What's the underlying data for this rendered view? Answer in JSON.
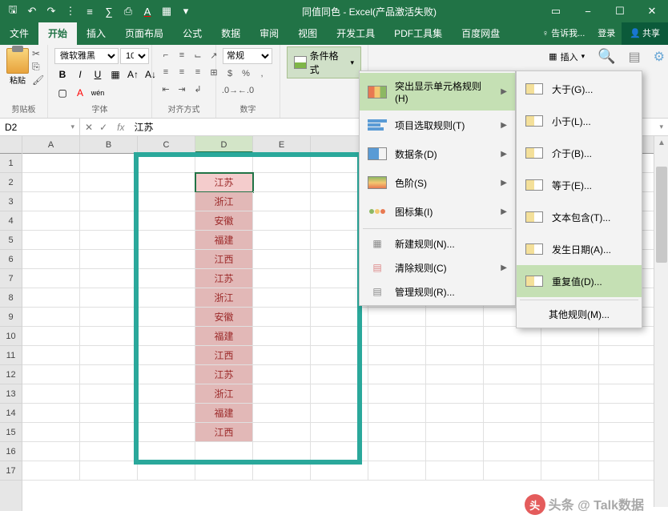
{
  "title": "同值同色 - Excel(产品激活失败)",
  "qat": [
    "🖫",
    "↶",
    "↷",
    "≡",
    "∑",
    "⎙",
    "A",
    "▦"
  ],
  "tabs": [
    "文件",
    "开始",
    "插入",
    "页面布局",
    "公式",
    "数据",
    "审阅",
    "视图",
    "开发工具",
    "PDF工具集",
    "百度网盘"
  ],
  "active_tab": "开始",
  "tellme": "♀ 告诉我...",
  "login": "登录",
  "share": "共享",
  "ribbon": {
    "paste": "粘贴",
    "clipboard_label": "剪贴板",
    "font_name": "微软雅黑",
    "font_size": "10",
    "font_label": "字体",
    "bold": "B",
    "italic": "I",
    "underline": "U",
    "align_label": "对齐方式",
    "num_format": "常规",
    "num_label": "数字",
    "cond_fmt": "条件格式",
    "insert": "插入"
  },
  "namebox": "D2",
  "formula": "江苏",
  "columns": [
    "A",
    "B",
    "C",
    "D",
    "E"
  ],
  "rows": [
    "1",
    "2",
    "3",
    "4",
    "5",
    "6",
    "7",
    "8",
    "9",
    "10",
    "11",
    "12",
    "13",
    "14",
    "15",
    "16",
    "17"
  ],
  "cell_data": [
    "江苏",
    "浙江",
    "安徽",
    "福建",
    "江西",
    "江苏",
    "浙江",
    "安徽",
    "福建",
    "江西",
    "江苏",
    "浙江",
    "福建",
    "江西"
  ],
  "menu1": {
    "highlight": "突出显示单元格规则(H)",
    "top10": "项目选取规则(T)",
    "databar": "数据条(D)",
    "colorscale": "色阶(S)",
    "iconset": "图标集(I)",
    "newrule": "新建规则(N)...",
    "clear": "清除规则(C)",
    "manage": "管理规则(R)..."
  },
  "menu2": {
    "gt": "大于(G)...",
    "lt": "小于(L)...",
    "between": "介于(B)...",
    "eq": "等于(E)...",
    "contains": "文本包含(T)...",
    "date": "发生日期(A)...",
    "dup": "重复值(D)...",
    "other": "其他规则(M)..."
  },
  "watermark": "头条 @ Talk数据"
}
